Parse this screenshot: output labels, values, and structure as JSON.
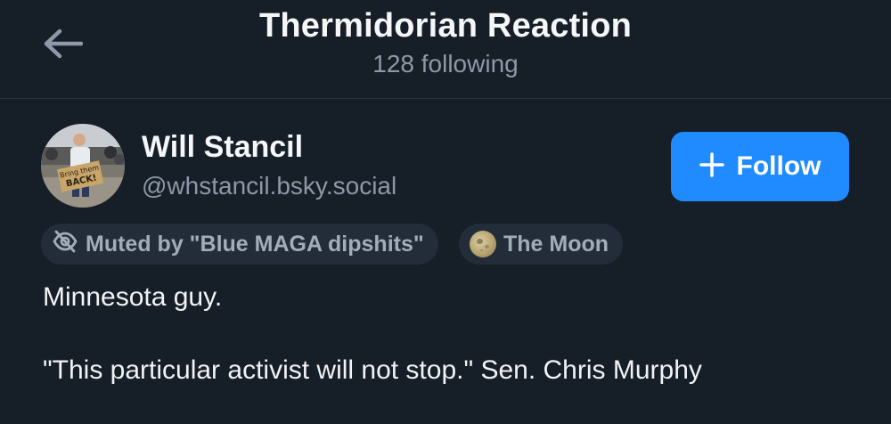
{
  "header": {
    "title": "Thermidorian Reaction",
    "subtitle": "128 following"
  },
  "profile": {
    "name": "Will Stancil",
    "handle": "@whstancil.bsky.social",
    "avatar_sign_text": "Bring them BACK!",
    "follow_label": "Follow",
    "accent_color": "#208bfe",
    "labels": [
      {
        "icon": "eye-slash-icon",
        "text": "Muted by \"Blue MAGA dipshits\""
      },
      {
        "icon": "moon-icon",
        "text": "The Moon"
      }
    ],
    "bio": [
      "Minnesota guy.",
      "\"This particular activist will not stop.\" Sen. Chris Murphy"
    ]
  }
}
